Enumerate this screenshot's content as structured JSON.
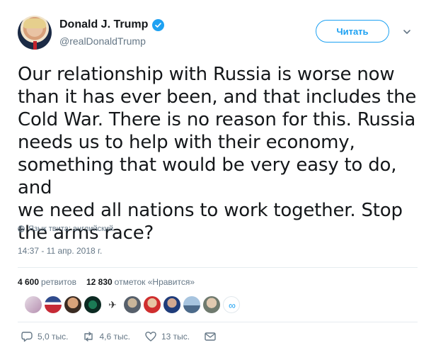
{
  "author": {
    "display_name": "Donald J. Trump",
    "handle": "@realDonaldTrump",
    "verified": true
  },
  "follow_button": {
    "label": "Читать"
  },
  "tweet": {
    "text": "Our relationship with Russia is worse now\nthan it has ever been, and that includes the\nCold War. There is no reason for this. Russia\nneeds us to help with their economy,\nsomething that would be very easy to do, and\nwe need all nations to work together. Stop\nthe arms race?",
    "language_note": "Язык твита: английский",
    "timestamp": "14:37 - 11 апр. 2018 г."
  },
  "stats": {
    "retweets_count": "4 600",
    "retweets_label": "ретвитов",
    "likes_count": "12 830",
    "likes_label": "отметок «Нравится»"
  },
  "actions": {
    "reply_count": "5,0 тыс.",
    "retweet_count": "4,6 тыс.",
    "like_count": "13 тыс."
  },
  "colors": {
    "accent": "#1da1f2",
    "text": "#14171a",
    "muted": "#657786",
    "divider": "#e6ecf0"
  },
  "icons": [
    "verified-badge-icon",
    "chevron-down-icon",
    "globe-icon",
    "reply-icon",
    "retweet-icon",
    "heart-icon",
    "direct-message-icon"
  ]
}
